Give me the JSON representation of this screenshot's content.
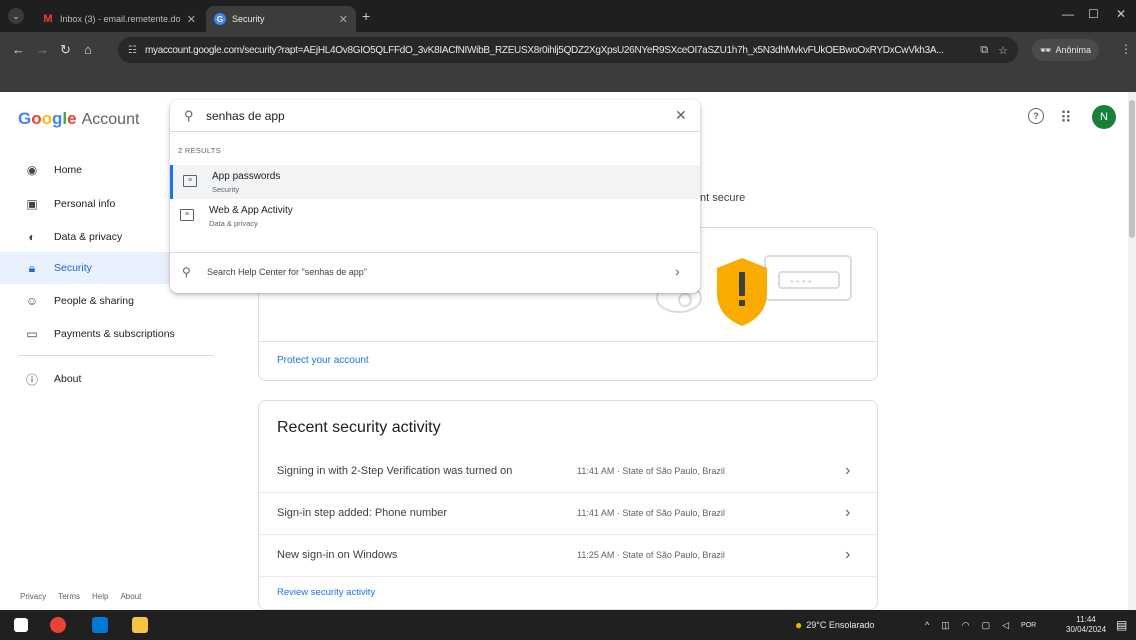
{
  "browser": {
    "tabs": [
      {
        "title": "Inbox (3) - email.remetente.do",
        "icon": "gmail-icon"
      },
      {
        "title": "Security",
        "icon": "google-icon"
      }
    ],
    "url": "myaccount.google.com/security?rapt=AEjHL4Ov8GIO5QLFFdO_3vK8IACfNIWibB_RZEUSX8r0ihlj5QDZ2XgXpsU26NYeR9SXceOI7aSZU1h7h_x5N3dhMvkvFUkOEBwoOxRYDxCwVkh3A...",
    "profile_label": "Anônima"
  },
  "header": {
    "logo_google": "Google",
    "logo_account": "Account",
    "avatar_letter": "N"
  },
  "search": {
    "query": "senhas de app",
    "results_count": "2 RESULTS",
    "results": [
      {
        "title": "App passwords",
        "subtitle": "Security"
      },
      {
        "title": "Web & App Activity",
        "subtitle": "Data & privacy"
      }
    ],
    "help_text": "Search Help Center for \"senhas de app\""
  },
  "sidebar": {
    "items": [
      {
        "label": "Home",
        "icon": "home-icon"
      },
      {
        "label": "Personal info",
        "icon": "id-card-icon"
      },
      {
        "label": "Data & privacy",
        "icon": "toggle-icon"
      },
      {
        "label": "Security",
        "icon": "lock-icon"
      },
      {
        "label": "People & sharing",
        "icon": "people-icon"
      },
      {
        "label": "Payments & subscriptions",
        "icon": "credit-card-icon"
      },
      {
        "label": "About",
        "icon": "info-icon"
      }
    ],
    "footer": [
      "Privacy",
      "Terms",
      "Help",
      "About"
    ]
  },
  "main": {
    "secure_text": "nt secure",
    "protect_link": "Protect your account",
    "recent": {
      "title": "Recent security activity",
      "rows": [
        {
          "text": "Signing in with 2-Step Verification was turned on",
          "meta": "11:41 AM · State of São Paulo, Brazil"
        },
        {
          "text": "Sign-in step added: Phone number",
          "meta": "11:41 AM · State of São Paulo, Brazil"
        },
        {
          "text": "New sign-in on Windows",
          "meta": "11:25 AM · State of São Paulo, Brazil"
        }
      ],
      "review_link": "Review security activity"
    }
  },
  "taskbar": {
    "weather": "29°C Ensolarado",
    "lang": "POR",
    "time": "11:44",
    "date": "30/04/2024"
  },
  "colors": {
    "accent": "#1a73e8",
    "selected_bg": "#e8f0fe",
    "shield": "#f9ab00",
    "avatar": "#188038"
  }
}
